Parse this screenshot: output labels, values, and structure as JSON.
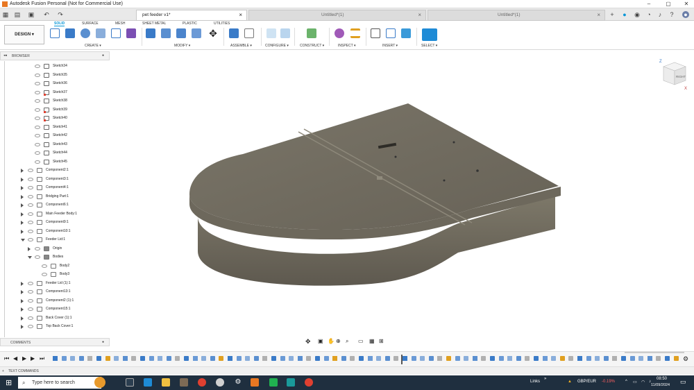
{
  "window": {
    "title": "Autodesk Fusion Personal (Not for Commercial Use)",
    "controls": [
      "–",
      "▢",
      "✕"
    ]
  },
  "tabs": [
    {
      "label": "pet feeder v1*",
      "active": true
    },
    {
      "label": "Untitled*(1)",
      "active": false
    },
    {
      "label": "Untitled*(1)",
      "active": false
    }
  ],
  "ribbon": {
    "workspace": "DESIGN ▾",
    "tabs": [
      "SOLID",
      "SURFACE",
      "MESH",
      "SHEET METAL",
      "PLASTIC",
      "UTILITIES"
    ],
    "groups": [
      "CREATE ▾",
      "MODIFY ▾",
      "ASSEMBLE ▾",
      "CONFIGURE ▾",
      "CONSTRUCT ▾",
      "INSPECT ▾",
      "INSERT ▾",
      "SELECT ▾"
    ]
  },
  "browser": {
    "title": "BROWSER",
    "items": [
      {
        "label": "Sketch34",
        "type": "sketch",
        "level": 2
      },
      {
        "label": "Sketch35",
        "type": "sketch",
        "level": 2
      },
      {
        "label": "Sketch36",
        "type": "sketch",
        "level": 2
      },
      {
        "label": "Sketch37",
        "type": "sketch-error",
        "level": 2
      },
      {
        "label": "Sketch38",
        "type": "sketch",
        "level": 2
      },
      {
        "label": "Sketch39",
        "type": "sketch-error",
        "level": 2
      },
      {
        "label": "Sketch40",
        "type": "sketch-error",
        "level": 2
      },
      {
        "label": "Sketch41",
        "type": "sketch",
        "level": 2
      },
      {
        "label": "Sketch42",
        "type": "sketch",
        "level": 2
      },
      {
        "label": "Sketch43",
        "type": "sketch",
        "level": 2
      },
      {
        "label": "Sketch44",
        "type": "sketch",
        "level": 2
      },
      {
        "label": "Sketch45",
        "type": "sketch",
        "level": 2
      },
      {
        "label": "Component2:1",
        "type": "component",
        "level": 1
      },
      {
        "label": "Component3:1",
        "type": "component",
        "level": 1
      },
      {
        "label": "Component4:1",
        "type": "component",
        "level": 1
      },
      {
        "label": "Bridging Part:1",
        "type": "component",
        "level": 1
      },
      {
        "label": "Component6:1",
        "type": "component",
        "level": 1
      },
      {
        "label": "Main Feeder Body:1",
        "type": "component",
        "level": 1
      },
      {
        "label": "Component9:1",
        "type": "component",
        "level": 1
      },
      {
        "label": "Component10:1",
        "type": "component",
        "level": 1
      },
      {
        "label": "Feeder Lid:1",
        "type": "component-open",
        "level": 1
      },
      {
        "label": "Origin",
        "type": "folder",
        "level": 2
      },
      {
        "label": "Bodies",
        "type": "folder-open",
        "level": 2
      },
      {
        "label": "Body2",
        "type": "body",
        "level": 3
      },
      {
        "label": "Body3",
        "type": "body",
        "level": 3
      },
      {
        "label": "Feeder Lid (1):1",
        "type": "component",
        "level": 1
      },
      {
        "label": "Component13:1",
        "type": "component",
        "level": 1
      },
      {
        "label": "Component2 (1):1",
        "type": "component",
        "level": 1
      },
      {
        "label": "Component15:1",
        "type": "component",
        "level": 1
      },
      {
        "label": "Back Cover (1):1",
        "type": "component",
        "level": 1
      },
      {
        "label": "Top Back Cover:1",
        "type": "component",
        "level": 1
      }
    ]
  },
  "comments": {
    "title": "COMMENTS"
  },
  "viewcube": {
    "face_label": "RIGHT",
    "axis_z": "Z",
    "axis_x": "X"
  },
  "text_commands": {
    "label": "TEXT COMMANDS"
  },
  "taskbar": {
    "search_placeholder": "Type here to search",
    "links_label": "Links",
    "ticker_symbol": "GBP/EUR",
    "ticker_change": "-0.19%",
    "time": "08:50",
    "date": "11/09/2024"
  },
  "colors": {
    "accent": "#0696d7",
    "model": "#6f6a5f",
    "taskbar": "#1f2f3f",
    "error": "#e04030"
  }
}
